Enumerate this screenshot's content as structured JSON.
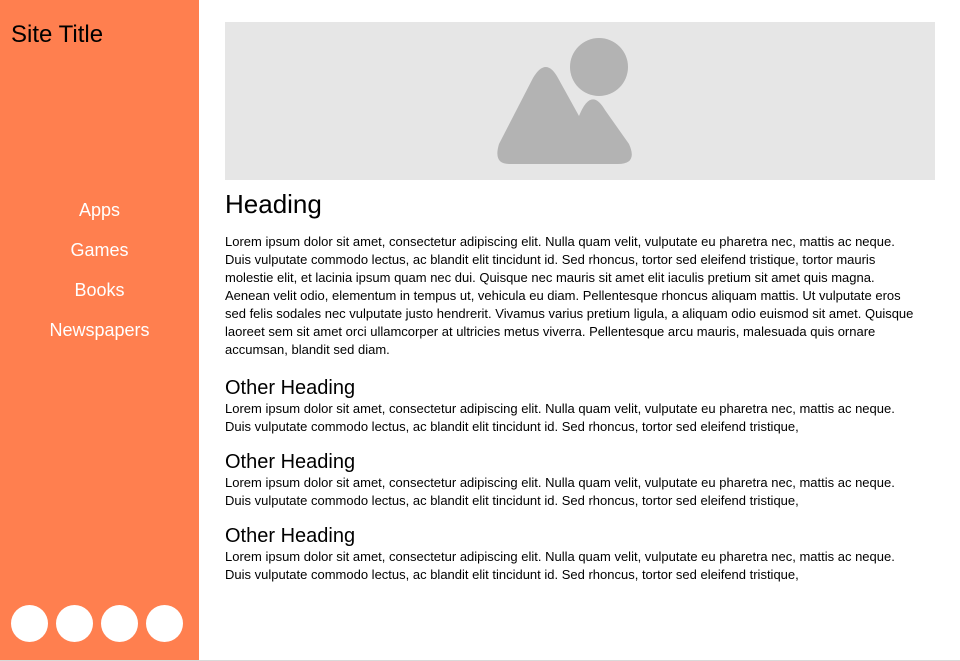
{
  "sidebar": {
    "site_title": "Site Title",
    "nav_items": [
      {
        "label": "Apps"
      },
      {
        "label": "Games"
      },
      {
        "label": "Books"
      },
      {
        "label": "Newspapers"
      }
    ],
    "social_icon_count": 4
  },
  "main": {
    "image_icon": "image-placeholder-icon",
    "heading": "Heading",
    "intro": "Lorem ipsum dolor sit amet, consectetur adipiscing elit. Nulla quam velit, vulputate eu pharetra nec, mattis ac neque. Duis vulputate commodo lectus, ac blandit elit tincidunt id. Sed rhoncus, tortor sed eleifend tristique, tortor mauris molestie elit, et lacinia ipsum quam nec dui. Quisque nec mauris sit amet elit iaculis pretium sit amet quis magna. Aenean velit odio, elementum in tempus ut, vehicula eu diam. Pellentesque rhoncus aliquam mattis. Ut vulputate eros sed felis sodales nec vulputate justo hendrerit. Vivamus varius pretium ligula, a aliquam odio euismod sit amet. Quisque laoreet sem sit amet orci ullamcorper at ultricies metus viverra. Pellentesque arcu mauris, malesuada quis ornare accumsan, blandit sed diam.",
    "sections": [
      {
        "heading": "Other Heading",
        "text": "Lorem ipsum dolor sit amet, consectetur adipiscing elit. Nulla quam velit, vulputate eu pharetra nec, mattis ac neque. Duis vulputate commodo lectus, ac blandit elit tincidunt id. Sed rhoncus, tortor sed eleifend tristique,"
      },
      {
        "heading": "Other Heading",
        "text": "Lorem ipsum dolor sit amet, consectetur adipiscing elit. Nulla quam velit, vulputate eu pharetra nec, mattis ac neque. Duis vulputate commodo lectus, ac blandit elit tincidunt id. Sed rhoncus, tortor sed eleifend tristique,"
      },
      {
        "heading": "Other Heading",
        "text": "Lorem ipsum dolor sit amet, consectetur adipiscing elit. Nulla quam velit, vulputate eu pharetra nec, mattis ac neque. Duis vulputate commodo lectus, ac blandit elit tincidunt id. Sed rhoncus, tortor sed eleifend tristique,"
      }
    ]
  },
  "colors": {
    "sidebar_bg": "#ff7f4f",
    "nav_text": "#ffffff",
    "image_bg": "#e6e6e6",
    "image_icon": "#b3b3b3"
  }
}
